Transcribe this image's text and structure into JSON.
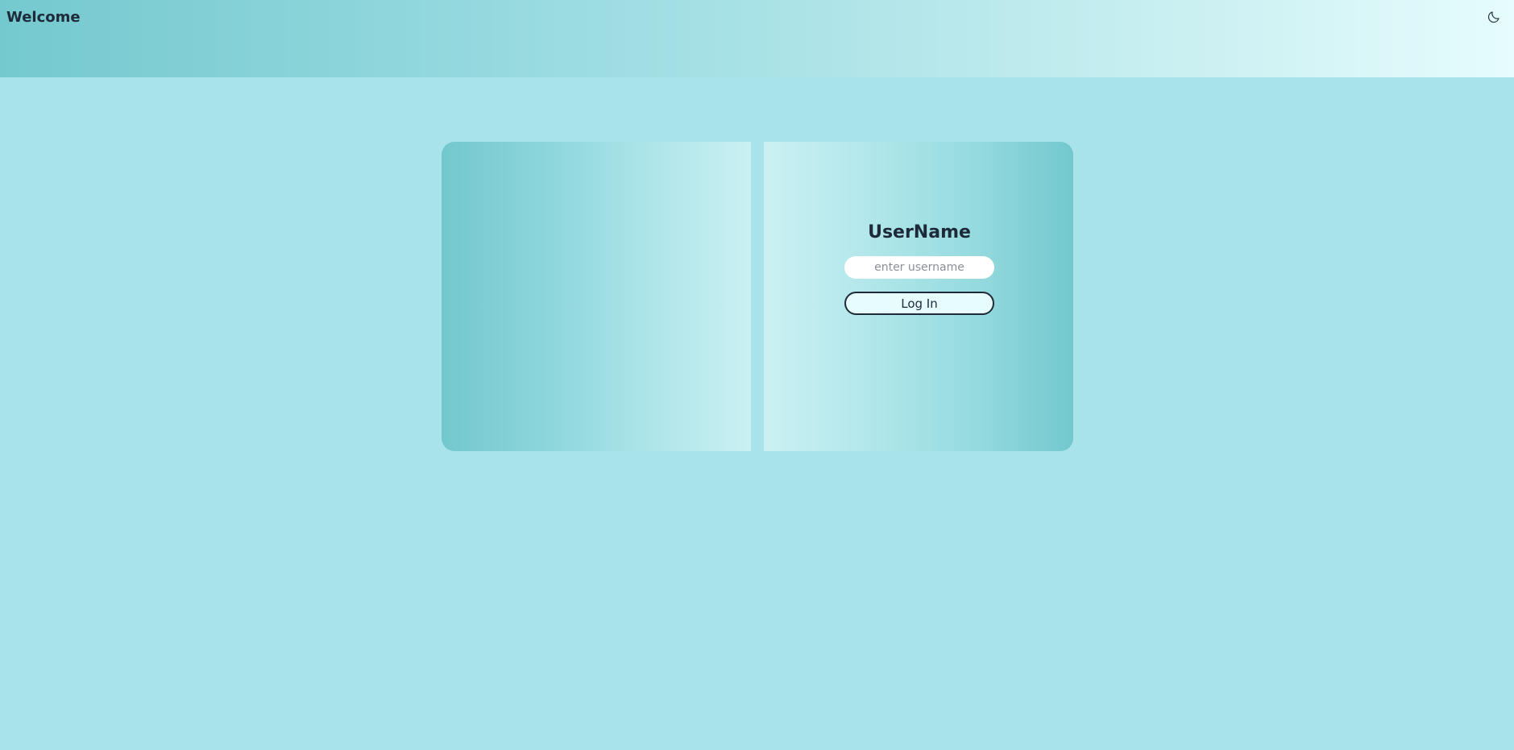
{
  "header": {
    "title": "Welcome",
    "theme_icon": "moon-icon"
  },
  "login": {
    "title": "UserName",
    "username_placeholder": "enter username",
    "username_value": "",
    "submit_label": "Log In"
  },
  "colors": {
    "page_background": "#a8e3ea",
    "accent_dark": "#73c8ce",
    "accent_light": "#e6fcfd",
    "text": "#1e2a3a"
  }
}
